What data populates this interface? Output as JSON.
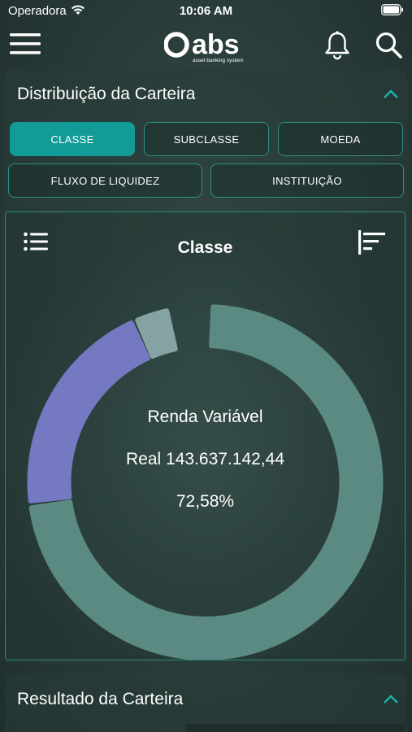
{
  "status_bar": {
    "carrier": "Operadora",
    "time": "10:06 AM"
  },
  "header": {
    "logo_text": "abs",
    "logo_tagline": "asset banking system"
  },
  "distribution_card": {
    "title": "Distribuição da Carteira",
    "filters": [
      {
        "label": "CLASSE",
        "active": true
      },
      {
        "label": "SUBCLASSE",
        "active": false
      },
      {
        "label": "MOEDA",
        "active": false
      },
      {
        "label": "FLUXO DE LIQUIDEZ",
        "active": false
      },
      {
        "label": "INSTITUIÇÃO",
        "active": false
      }
    ],
    "chart_title": "Classe",
    "center": {
      "name": "Renda Variável",
      "value": "Real 143.637.142,44",
      "percent": "72,58%"
    }
  },
  "chart_data": {
    "type": "pie",
    "title": "Classe",
    "slices": [
      {
        "name": "Renda Variável",
        "value": 72.58,
        "color": "#5a8a82"
      },
      {
        "name": "",
        "value": 20.4,
        "color": "#7479c2"
      },
      {
        "name": "",
        "value": 3.4,
        "color": "#84a3a2"
      }
    ]
  },
  "result_card": {
    "title": "Resultado da Carteira"
  },
  "colors": {
    "accent": "#139b98",
    "border": "#2f8f8b",
    "slice_main": "#5a8a82",
    "slice_purple": "#7479c2",
    "slice_light": "#84a3a2"
  }
}
